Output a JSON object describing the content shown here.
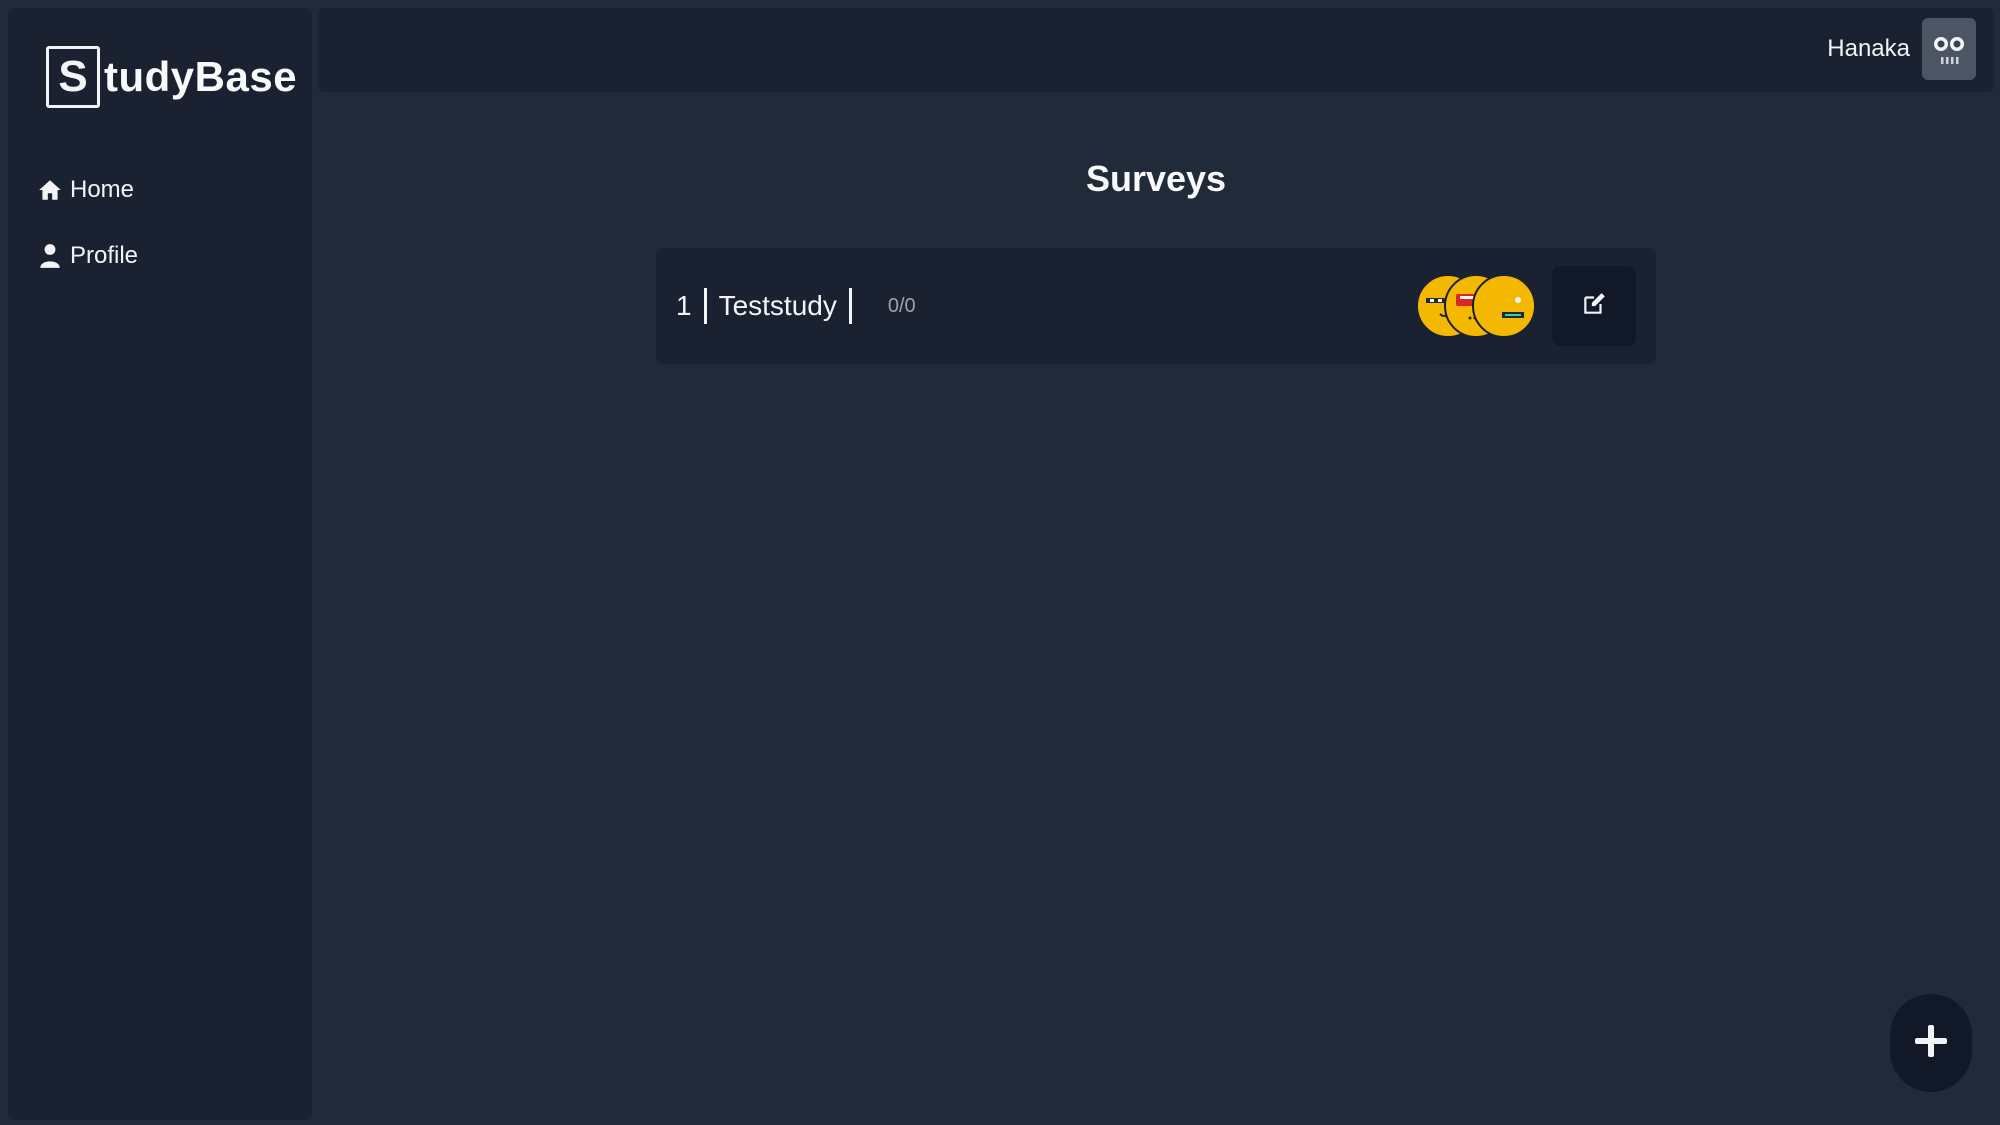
{
  "brand": {
    "logo_letter": "S",
    "logo_text": "tudyBase"
  },
  "sidebar": {
    "items": [
      {
        "label": "Home",
        "icon": "home-icon"
      },
      {
        "label": "Profile",
        "icon": "user-icon"
      }
    ]
  },
  "header": {
    "username": "Hanaka",
    "avatar_icon": "robot-avatar-icon"
  },
  "main": {
    "title": "Surveys",
    "surveys": [
      {
        "id": "1",
        "name": "Teststudy",
        "progress": "0/0"
      }
    ]
  },
  "colors": {
    "background": "#202a39",
    "panel": "#1a2130",
    "badge": "#f5b800",
    "button": "#111827"
  }
}
